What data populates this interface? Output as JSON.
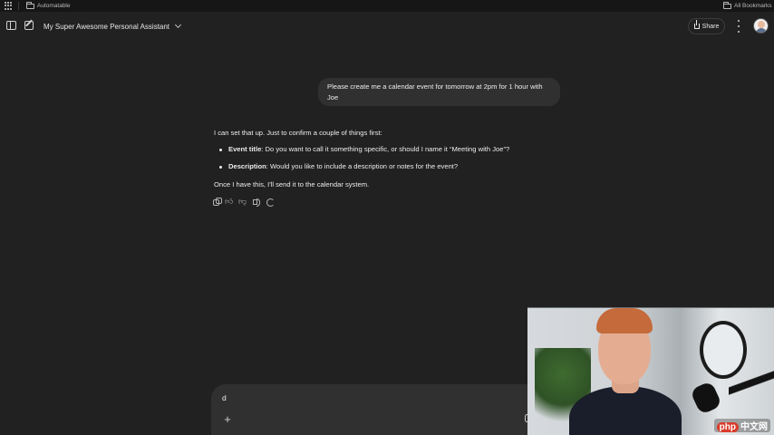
{
  "bookmarks": {
    "left_folder": "Automatable",
    "right_folder": "All Bookmarks"
  },
  "header": {
    "title": "My Super Awesome Personal Assistant",
    "share_label": "Share"
  },
  "conversation": {
    "user_message": "Please create me a calendar event for tomorrow at 2pm for 1 hour with Joe",
    "assistant": {
      "intro": "I can set that up. Just to confirm a couple of things first:",
      "bullets": [
        {
          "term": "Event title",
          "text": ": Do you want to call it something specific, or should I name it “Meeting with Joe”?"
        },
        {
          "term": "Description",
          "text": ": Would you like to include a description or notes for the event?"
        }
      ],
      "outro": "Once I have this, I'll send it to the calendar system."
    }
  },
  "composer": {
    "value": "d",
    "plus_label": "+"
  },
  "watermark": {
    "text": "php",
    "suffix": "中文网"
  },
  "icons": [
    "apps-icon",
    "folder-icon",
    "sidebar-toggle-icon",
    "new-chat-icon",
    "chevron-down-icon",
    "share-icon",
    "more-icon",
    "avatar",
    "copy-icon",
    "thumbs-up-icon",
    "thumbs-down-icon",
    "read-aloud-icon",
    "regenerate-icon",
    "plus-icon",
    "mic-icon"
  ]
}
